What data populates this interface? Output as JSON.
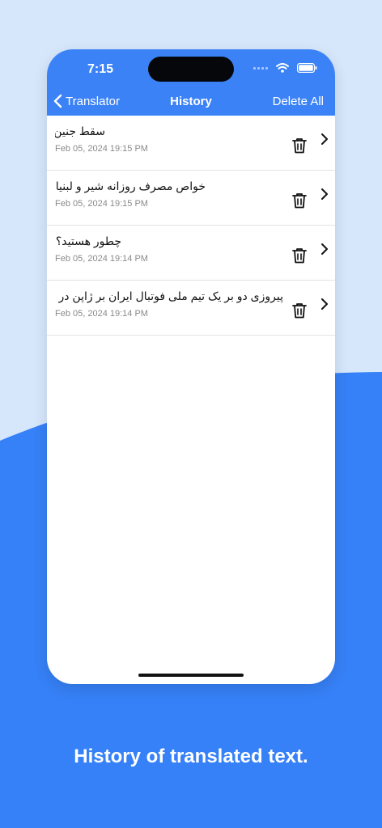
{
  "statusbar": {
    "time": "7:15"
  },
  "navbar": {
    "back_label": "Translator",
    "title": "History",
    "delete_all_label": "Delete All"
  },
  "history": [
    {
      "text": "سقط جنین",
      "date": "Feb 05, 2024 19:15 PM"
    },
    {
      "text": "خواص مصرف روزانه شیر و لبنیات",
      "date": "Feb 05, 2024 19:15 PM"
    },
    {
      "text": "چطور هستید؟",
      "date": "Feb 05, 2024 19:14 PM"
    },
    {
      "text": "پیروزی دو بر یک تیم ملی فوتبال ایران بر ژاپن در مر..",
      "date": "Feb 05, 2024 19:14 PM"
    }
  ],
  "caption": "History of translated text.",
  "colors": {
    "accent": "#3b82f6",
    "background_light": "#d6e6fb",
    "wave": "#3681f7"
  },
  "icons": [
    "back-chevron-icon",
    "wifi-icon",
    "battery-icon",
    "trash-icon",
    "chevron-right-icon"
  ]
}
